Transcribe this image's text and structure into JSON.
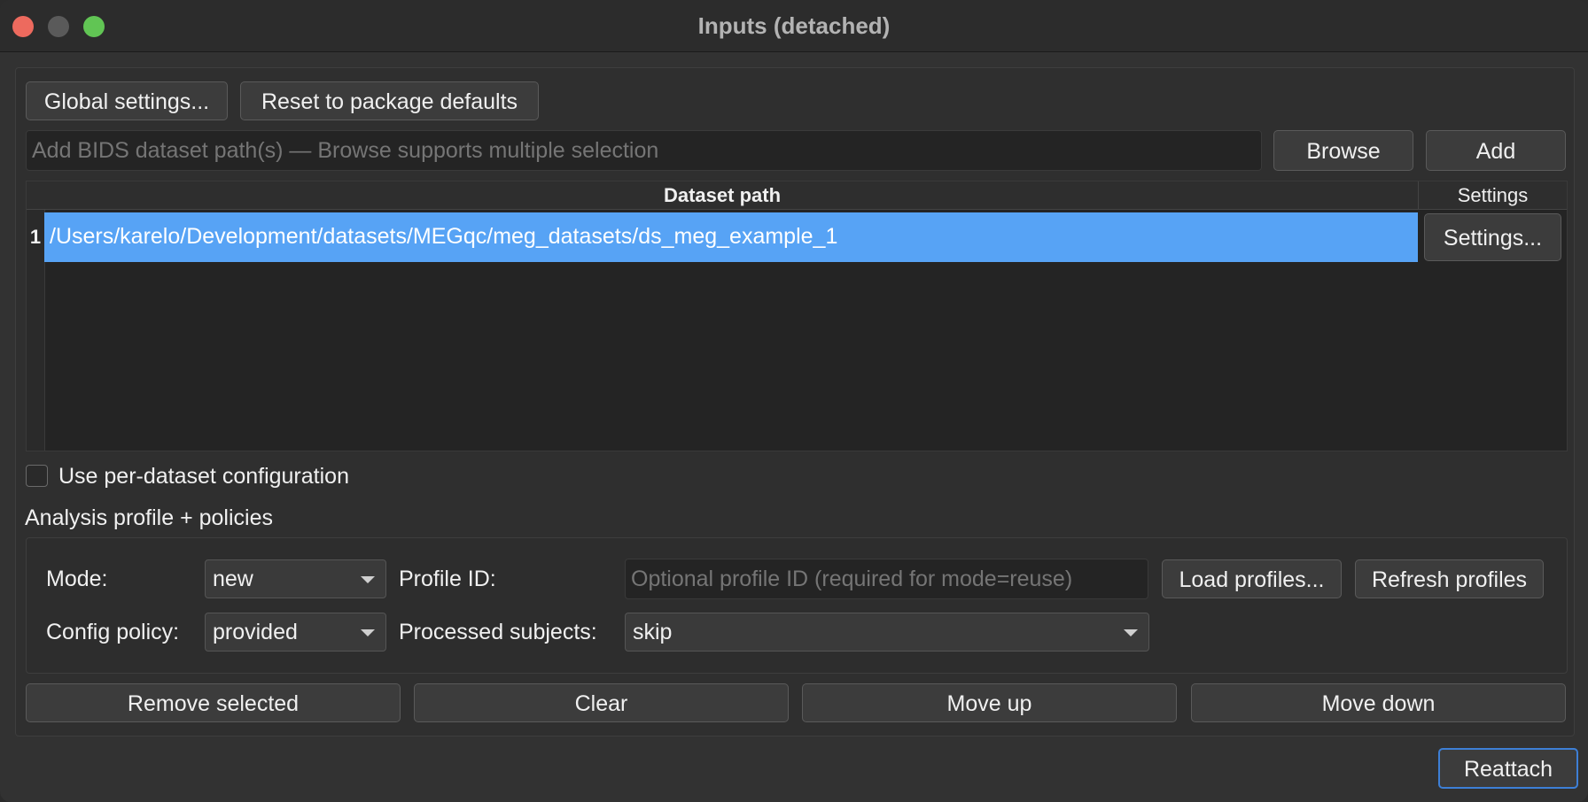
{
  "window": {
    "title": "Inputs (detached)"
  },
  "toolbar": {
    "global_settings_label": "Global settings...",
    "reset_defaults_label": "Reset to package defaults"
  },
  "path_input": {
    "placeholder": "Add BIDS dataset path(s) — Browse supports multiple selection",
    "browse_label": "Browse",
    "add_label": "Add"
  },
  "table": {
    "headers": [
      "Dataset path",
      "Settings"
    ],
    "rows": [
      {
        "index": "1",
        "path": "/Users/karelo/Development/datasets/MEGqc/meg_datasets/ds_meg_example_1",
        "settings_label": "Settings..."
      }
    ],
    "selection_color": "#57a3f5"
  },
  "per_dataset": {
    "label": "Use per-dataset configuration",
    "checked": false
  },
  "analysis": {
    "section_title": "Analysis profile + policies",
    "mode_label": "Mode:",
    "mode_value": "new",
    "profile_id_label": "Profile ID:",
    "profile_id_placeholder": "Optional profile ID (required for mode=reuse)",
    "load_profiles_label": "Load profiles...",
    "refresh_profiles_label": "Refresh profiles",
    "config_policy_label": "Config policy:",
    "config_policy_value": "provided",
    "processed_subjects_label": "Processed subjects:",
    "processed_subjects_value": "skip"
  },
  "actions": {
    "remove_selected": "Remove selected",
    "clear": "Clear",
    "move_up": "Move up",
    "move_down": "Move down"
  },
  "footer": {
    "reattach_label": "Reattach"
  }
}
